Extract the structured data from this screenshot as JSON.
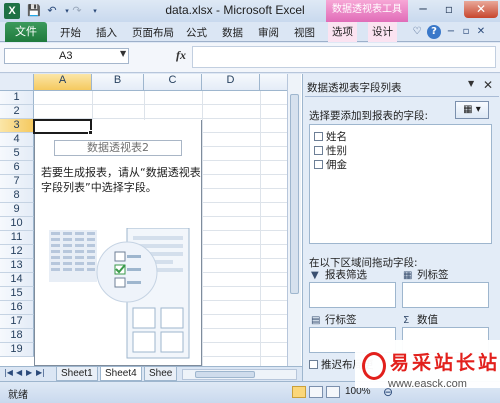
{
  "window": {
    "title": "data.xlsx - Microsoft Excel",
    "context_tab_group": "数据透视表工具",
    "app_icon": "X",
    "minimize": "─",
    "restore": "▫",
    "close": "✕"
  },
  "ribbon": {
    "file_tab": "文件",
    "tabs": [
      "开始",
      "插入",
      "页面布局",
      "公式",
      "数据",
      "审阅",
      "视图"
    ],
    "context_tabs": [
      "选项",
      "设计"
    ]
  },
  "formula_bar": {
    "name_box": "A3",
    "fx": "fx",
    "formula": ""
  },
  "grid": {
    "columns": [
      "A",
      "B",
      "C",
      "D"
    ],
    "rows": [
      "1",
      "2",
      "3",
      "4",
      "5",
      "6",
      "7",
      "8",
      "9",
      "10",
      "11",
      "12",
      "13",
      "14",
      "15",
      "16",
      "17",
      "18",
      "19"
    ],
    "selected_cell": "A3",
    "pivot_placeholder": {
      "name": "数据透视表2",
      "message": "若要生成报表，请从“数据透视表字段列表”中选择字段。"
    }
  },
  "sheet_tabs": {
    "tabs": [
      "Sheet1",
      "Sheet4",
      "Shee"
    ],
    "active": "Sheet4"
  },
  "status_bar": {
    "status": "就绪",
    "zoom": "100%"
  },
  "field_list": {
    "title": "数据透视表字段列表",
    "choose_label": "选择要添加到报表的字段:",
    "fields": [
      {
        "name": "姓名",
        "checked": false
      },
      {
        "name": "性别",
        "checked": false
      },
      {
        "name": "佣金",
        "checked": false
      }
    ],
    "drag_label": "在以下区域间拖动字段:",
    "areas": {
      "report_filter": "报表筛选",
      "column_labels": "列标签",
      "row_labels": "行标签",
      "values": "数值"
    },
    "defer_label": "推迟布局更"
  },
  "watermark": {
    "text": "易采站长站",
    "url": "www.easck.com"
  }
}
